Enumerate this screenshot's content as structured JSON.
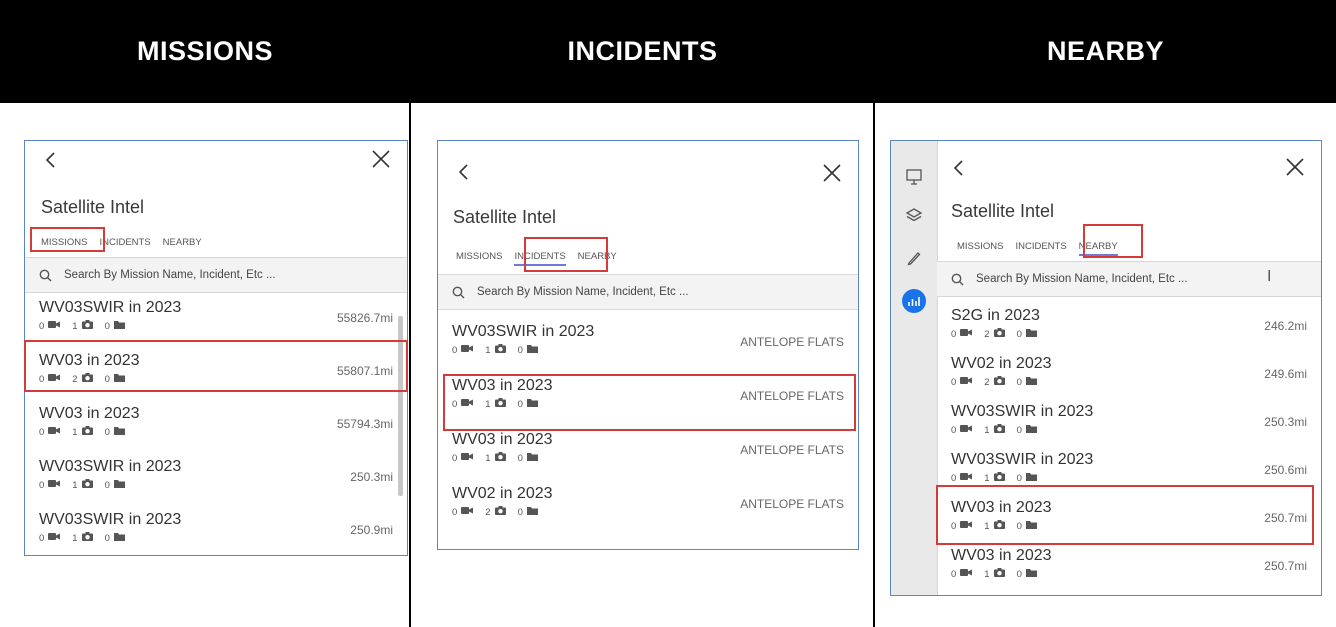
{
  "headers": [
    "MISSIONS",
    "INCIDENTS",
    "NEARBY"
  ],
  "app_title": "Satellite Intel",
  "tabs": [
    "MISSIONS",
    "INCIDENTS",
    "NEARBY"
  ],
  "search_placeholder": "Search By Mission Name, Incident, Etc ...",
  "highlight_color": "#d63b3b",
  "accent_color": "#1a73e8",
  "panels": [
    {
      "active_tab": "MISSIONS",
      "rows": [
        {
          "name": "WV03SWIR in 2023",
          "videos": "0",
          "photos": "1",
          "files": "0",
          "value": "55826.7mi"
        },
        {
          "name": "WV03 in 2023",
          "videos": "0",
          "photos": "2",
          "files": "0",
          "value": "55807.1mi"
        },
        {
          "name": "WV03 in 2023",
          "videos": "0",
          "photos": "1",
          "files": "0",
          "value": "55794.3mi"
        },
        {
          "name": "WV03SWIR in 2023",
          "videos": "0",
          "photos": "1",
          "files": "0",
          "value": "250.3mi"
        },
        {
          "name": "WV03SWIR in 2023",
          "videos": "0",
          "photos": "1",
          "files": "0",
          "value": "250.9mi"
        }
      ]
    },
    {
      "active_tab": "INCIDENTS",
      "rows": [
        {
          "name": "WV03SWIR in 2023",
          "videos": "0",
          "photos": "1",
          "files": "0",
          "value": "ANTELOPE FLATS"
        },
        {
          "name": "WV03 in 2023",
          "videos": "0",
          "photos": "1",
          "files": "0",
          "value": "ANTELOPE FLATS"
        },
        {
          "name": "WV03 in 2023",
          "videos": "0",
          "photos": "1",
          "files": "0",
          "value": "ANTELOPE FLATS"
        },
        {
          "name": "WV02 in 2023",
          "videos": "0",
          "photos": "2",
          "files": "0",
          "value": "ANTELOPE FLATS"
        }
      ]
    },
    {
      "active_tab": "NEARBY",
      "rail_icons": [
        "presentation-icon",
        "layers-icon",
        "pencil-icon",
        "analytics-icon"
      ],
      "rows": [
        {
          "name": "S2G in 2023",
          "videos": "0",
          "photos": "2",
          "files": "0",
          "value": "246.2mi"
        },
        {
          "name": "WV02 in 2023",
          "videos": "0",
          "photos": "2",
          "files": "0",
          "value": "249.6mi"
        },
        {
          "name": "WV03SWIR in 2023",
          "videos": "0",
          "photos": "1",
          "files": "0",
          "value": "250.3mi"
        },
        {
          "name": "WV03SWIR in 2023",
          "videos": "0",
          "photos": "1",
          "files": "0",
          "value": "250.6mi"
        },
        {
          "name": "WV03 in 2023",
          "videos": "0",
          "photos": "1",
          "files": "0",
          "value": "250.7mi"
        },
        {
          "name": "WV03 in 2023",
          "videos": "0",
          "photos": "1",
          "files": "0",
          "value": "250.7mi"
        }
      ]
    }
  ]
}
